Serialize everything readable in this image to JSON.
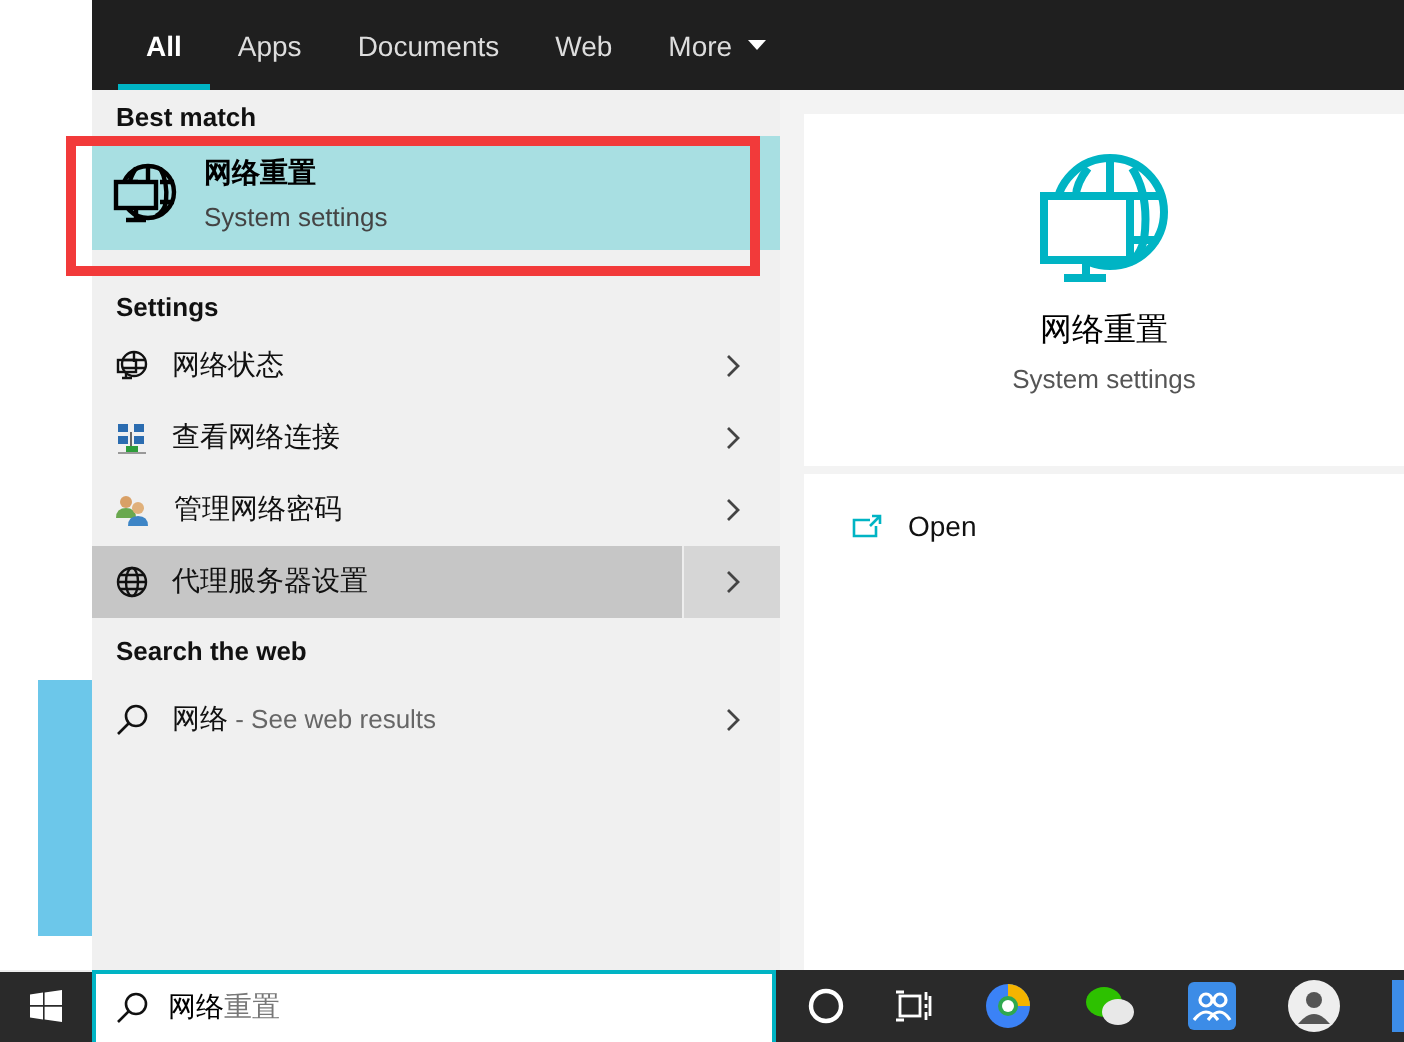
{
  "tabs": [
    {
      "label": "All",
      "selected": true,
      "kind": "plain"
    },
    {
      "label": "Apps",
      "selected": false,
      "kind": "plain"
    },
    {
      "label": "Documents",
      "selected": false,
      "kind": "plain"
    },
    {
      "label": "Web",
      "selected": false,
      "kind": "plain"
    },
    {
      "label": "More",
      "selected": false,
      "kind": "dropdown"
    }
  ],
  "best_match": {
    "heading": "Best match",
    "item": {
      "title": "网络重置",
      "subtitle": "System settings",
      "selected": true
    }
  },
  "settings": {
    "heading": "Settings",
    "items": [
      {
        "label": "网络状态",
        "kind": "globe-monitor",
        "selected": false
      },
      {
        "label": "查看网络连接",
        "kind": "network",
        "selected": false
      },
      {
        "label": "管理网络密码",
        "kind": "users",
        "selected": false
      },
      {
        "label": "代理服务器设置",
        "kind": "globe",
        "selected": true
      }
    ]
  },
  "search_web": {
    "heading": "Search the web",
    "item": {
      "query": "网络",
      "suffix": " - See web results"
    }
  },
  "preview": {
    "title": "网络重置",
    "subtitle": "System settings",
    "actions": [
      {
        "label": "Open"
      }
    ]
  },
  "taskbar": {
    "search": {
      "value": "网络",
      "suggestion": "重置"
    }
  }
}
